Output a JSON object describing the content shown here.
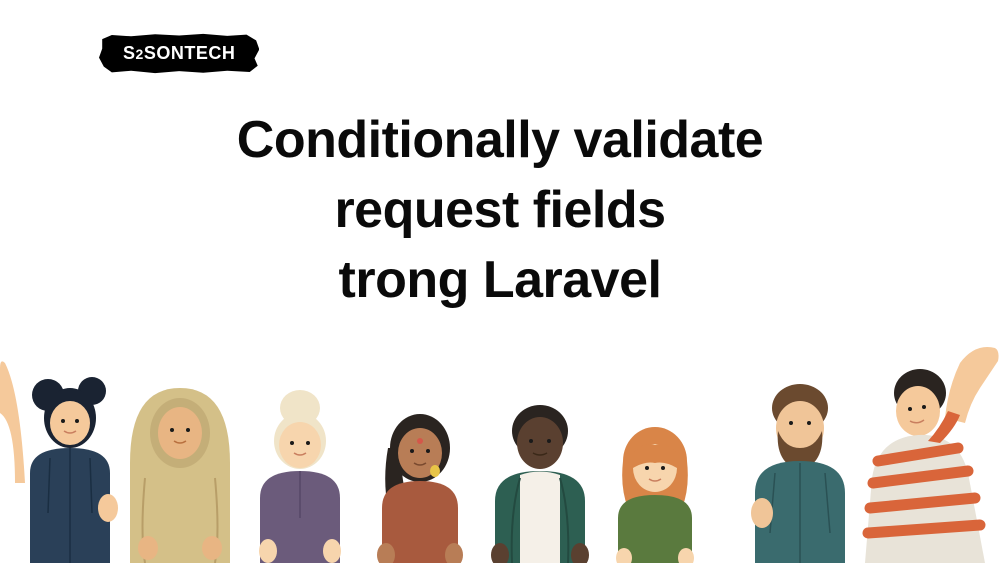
{
  "logo": {
    "prefix": "S",
    "small": "2",
    "suffix": "SONTECH"
  },
  "heading": {
    "line1": "Conditionally validate",
    "line2": "request fields",
    "line3": "trong Laravel"
  }
}
